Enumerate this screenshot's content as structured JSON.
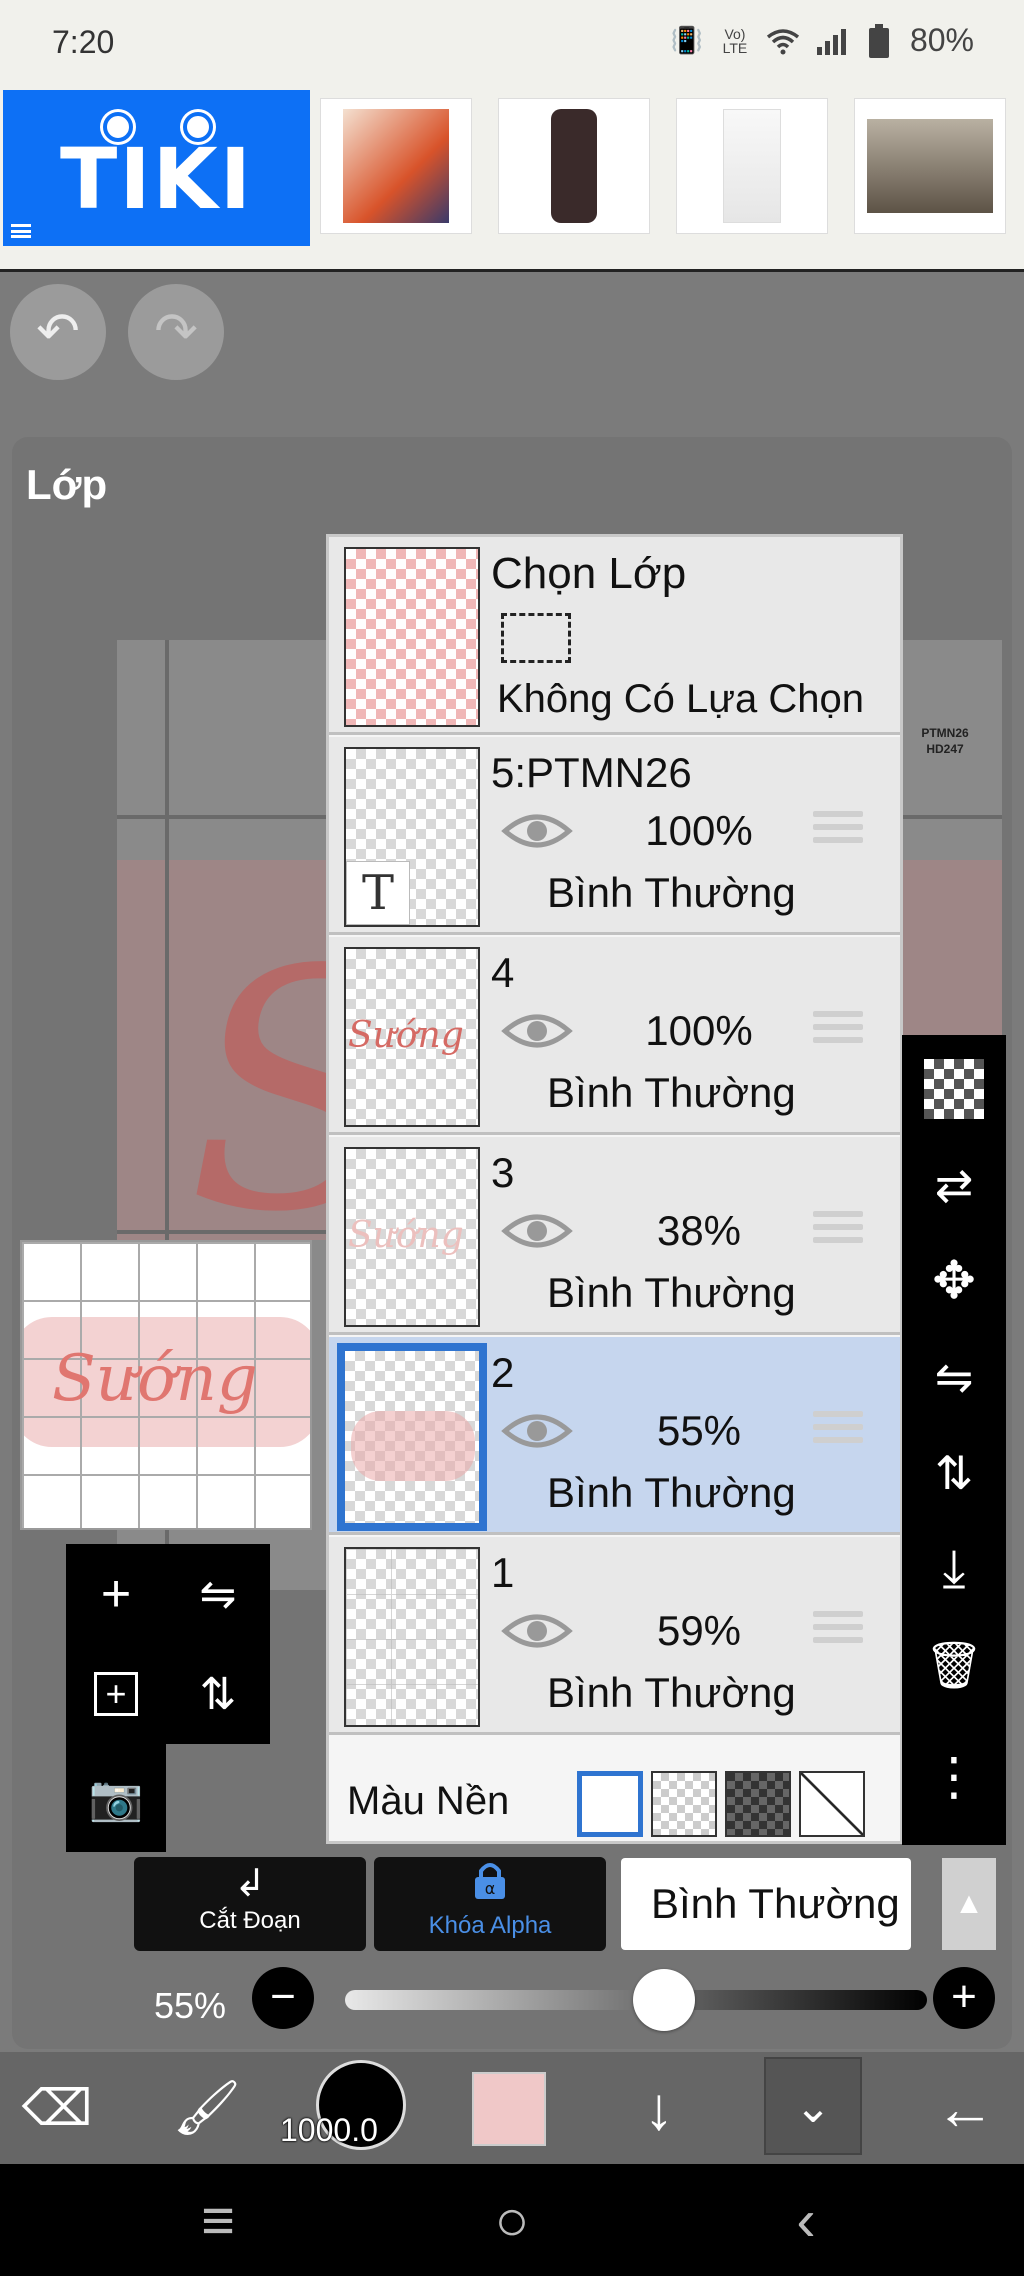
{
  "status_bar": {
    "time": "7:20",
    "signal_label": "Vo) LTE",
    "battery": "80%"
  },
  "ad_banner": {
    "brand": "TIKI"
  },
  "panel": {
    "title": "Lớp",
    "canvas_text_line1": "PTMN26",
    "canvas_text_line2": "HD247"
  },
  "selection_row": {
    "title": "Chọn Lớp",
    "status": "Không Có Lựa Chọn"
  },
  "layers": [
    {
      "name": "5:PTMN26",
      "opacity": "100%",
      "blend": "Bình Thường",
      "thumb": "text"
    },
    {
      "name": "4",
      "opacity": "100%",
      "blend": "Bình Thường",
      "thumb": "word-strong",
      "word": "Sướng"
    },
    {
      "name": "3",
      "opacity": "38%",
      "blend": "Bình Thường",
      "thumb": "word-faint",
      "word": "Sướng"
    },
    {
      "name": "2",
      "opacity": "55%",
      "blend": "Bình Thường",
      "thumb": "blob",
      "selected": true
    },
    {
      "name": "1",
      "opacity": "59%",
      "blend": "Bình Thường",
      "thumb": "grid"
    }
  ],
  "background_color": {
    "label": "Màu Nền"
  },
  "preview": {
    "word": "Sướng"
  },
  "buttons": {
    "clip": "Cắt Đoạn",
    "alpha_lock": "Khóa Alpha",
    "alpha_lock_icon_letter": "α",
    "blend_mode": "Bình Thường"
  },
  "opacity_slider": {
    "label": "55%",
    "value": 0.55
  },
  "app_toolbar": {
    "brush_size": "1000.0",
    "current_color": "#f0c8c8"
  },
  "colors": {
    "selected_blue": "#2f74d0",
    "tiki_blue": "#0d70f5",
    "alpha_lock_blue": "#4a8fe6",
    "accent_pink": "#e07670"
  }
}
